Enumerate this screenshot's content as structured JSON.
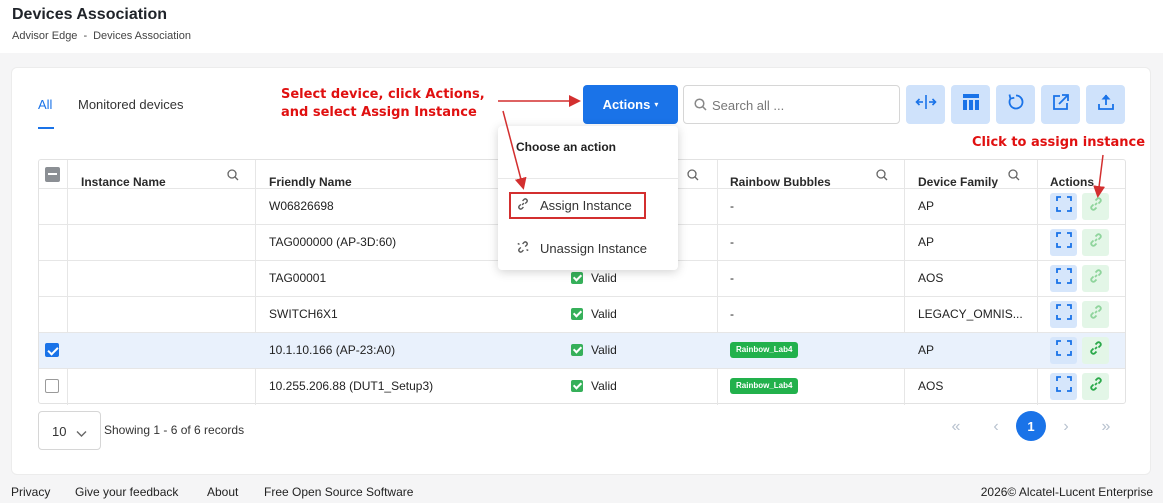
{
  "header": {
    "title": "Devices Association",
    "breadcrumb": [
      "Advisor Edge",
      "-",
      "Devices Association"
    ]
  },
  "tabs": [
    {
      "label": "All",
      "active": true
    },
    {
      "label": "Monitored devices",
      "active": false
    }
  ],
  "toolbar": {
    "actions_label": "Actions",
    "search_placeholder": "Search all ...",
    "tool_icons": [
      "resize-columns-icon",
      "table-layout-icon",
      "refresh-icon",
      "open-external-icon",
      "upload-icon"
    ]
  },
  "dropdown": {
    "title": "Choose an action",
    "items": [
      {
        "label": "Assign Instance",
        "icon": "link-icon"
      },
      {
        "label": "Unassign Instance",
        "icon": "unlink-icon"
      }
    ]
  },
  "table": {
    "columns": [
      "Instance Name",
      "Friendly Name",
      "Rainbow Bubbles",
      "Device Family",
      "Actions"
    ],
    "rows": [
      {
        "selected": false,
        "instance": "",
        "friendly": "W06826698",
        "status": "",
        "bubble": "-",
        "family": "AP"
      },
      {
        "selected": false,
        "instance": "",
        "friendly": "TAG000000 (AP-3D:60)",
        "status": "",
        "bubble": "-",
        "family": "AP"
      },
      {
        "selected": false,
        "instance": "",
        "friendly": "TAG00001",
        "status": "Valid",
        "bubble": "-",
        "family": "AOS"
      },
      {
        "selected": false,
        "instance": "",
        "friendly": "SWITCH6X1",
        "status": "Valid",
        "bubble": "-",
        "family": "LEGACY_OMNIS..."
      },
      {
        "selected": true,
        "instance": "",
        "friendly": "10.1.10.166 (AP-23:A0)",
        "status": "Valid",
        "bubble": "Rainbow_Lab4",
        "family": "AP"
      },
      {
        "selected": false,
        "instance": "",
        "friendly": "10.255.206.88 (DUT1_Setup3)",
        "status": "Valid",
        "bubble": "Rainbow_Lab4",
        "family": "AOS"
      }
    ]
  },
  "pagination": {
    "page_size": "10",
    "records_text": "Showing 1 - 6 of 6 records",
    "current_page": "1"
  },
  "footer": {
    "links": [
      "Privacy",
      "Give your feedback",
      "About",
      "Free Open Source Software"
    ],
    "copyright": "2026© Alcatel-Lucent Enterprise"
  },
  "annotations": {
    "select_line1": "Select device, click Actions,",
    "select_line2": "and select Assign Instance",
    "click_assign": "Click to assign instance"
  },
  "colors": {
    "accent": "#1a73e8",
    "valid": "#36b05a",
    "badge": "#22b14c",
    "annotation": "#e01010"
  }
}
